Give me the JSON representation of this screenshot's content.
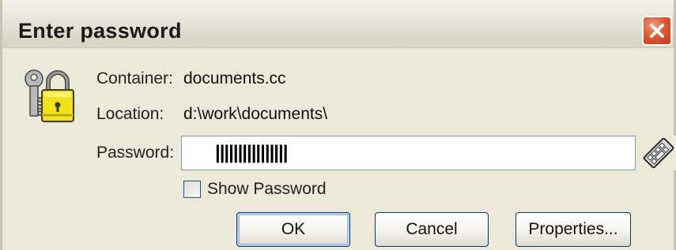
{
  "window": {
    "title": "Enter password",
    "close_icon": "close-icon"
  },
  "info": {
    "container_label": "Container:",
    "container_value": "documents.cc",
    "location_label": "Location:",
    "location_value": "d:\\work\\documents\\",
    "password_label": "Password:"
  },
  "password_field": {
    "masked_value": "||||||||||||||||"
  },
  "show_password": {
    "label": "Show Password",
    "checked": false
  },
  "buttons": {
    "ok": "OK",
    "cancel": "Cancel",
    "properties": "Properties..."
  },
  "icons": {
    "dialog_icon": "keys-lock-icon",
    "keyboard_icon": "keyboard-icon"
  },
  "colors": {
    "dialog_bg": "#ece9d8",
    "close_red": "#df5a33",
    "lock_yellow": "#f2e21a",
    "input_border": "#7f9db9",
    "button_border": "#003c74"
  }
}
